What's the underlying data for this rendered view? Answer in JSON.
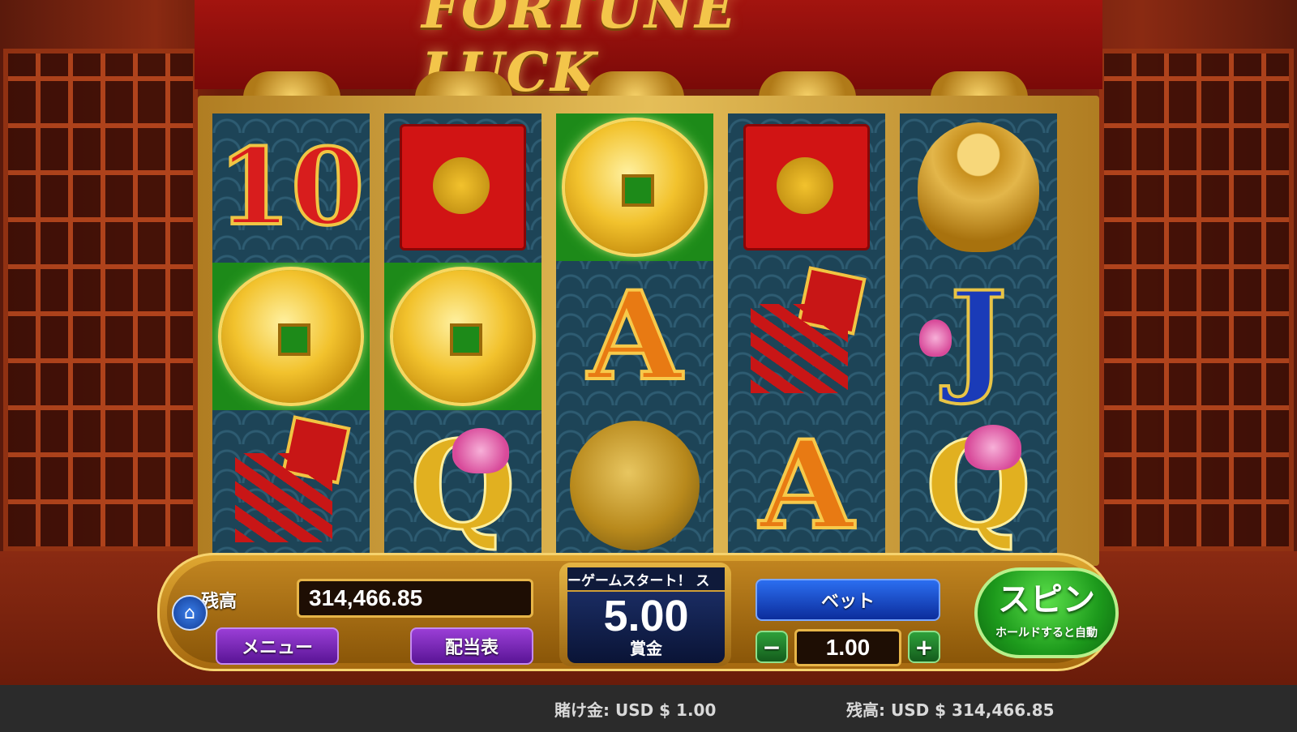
{
  "game": {
    "title": "FORTUNE LUCK"
  },
  "reels": [
    {
      "id": 1,
      "symbols": [
        {
          "symbol": "10",
          "win": false
        },
        {
          "symbol": "gold-coin",
          "win": true
        },
        {
          "symbol": "firecracker",
          "win": false
        }
      ]
    },
    {
      "id": 2,
      "symbols": [
        {
          "symbol": "red-envelope",
          "win": false
        },
        {
          "symbol": "gold-coin",
          "win": true
        },
        {
          "symbol": "Q",
          "win": false
        }
      ]
    },
    {
      "id": 3,
      "symbols": [
        {
          "symbol": "gold-coin",
          "win": true
        },
        {
          "symbol": "A",
          "win": false
        },
        {
          "symbol": "gong",
          "win": false
        }
      ]
    },
    {
      "id": 4,
      "symbols": [
        {
          "symbol": "red-envelope",
          "win": false
        },
        {
          "symbol": "firecracker",
          "win": false
        },
        {
          "symbol": "A",
          "win": false
        }
      ]
    },
    {
      "id": 5,
      "symbols": [
        {
          "symbol": "buddha",
          "win": false
        },
        {
          "symbol": "J",
          "win": false
        },
        {
          "symbol": "Q",
          "win": false
        }
      ]
    }
  ],
  "symbol_text": {
    "ten": "10",
    "a": "A",
    "q": "Q",
    "j": "J"
  },
  "controls": {
    "balance_label": "残高",
    "balance_value": "314,466.85",
    "menu_label": "メニュー",
    "paytable_label": "配当表",
    "ticker_text": "ーゲームスタート！ ス",
    "win_value": "5.00",
    "win_label": "賞金",
    "bet_label": "ベット",
    "bet_value": "1.00",
    "minus_label": "−",
    "plus_label": "+",
    "spin_label": "スピン",
    "spin_sub": "ホールドすると自動",
    "home_icon": "home-icon"
  },
  "status": {
    "bet_text": "賭け金:  USD $ 1.00",
    "balance_text": "残高:  USD $ 314,466.85"
  },
  "colors": {
    "win_cell": "#1d8a19",
    "spin_button": "#1d9a1c",
    "bet_button": "#0c2d9c",
    "menu_button": "#5a1596",
    "gold": "#f3c54a"
  }
}
